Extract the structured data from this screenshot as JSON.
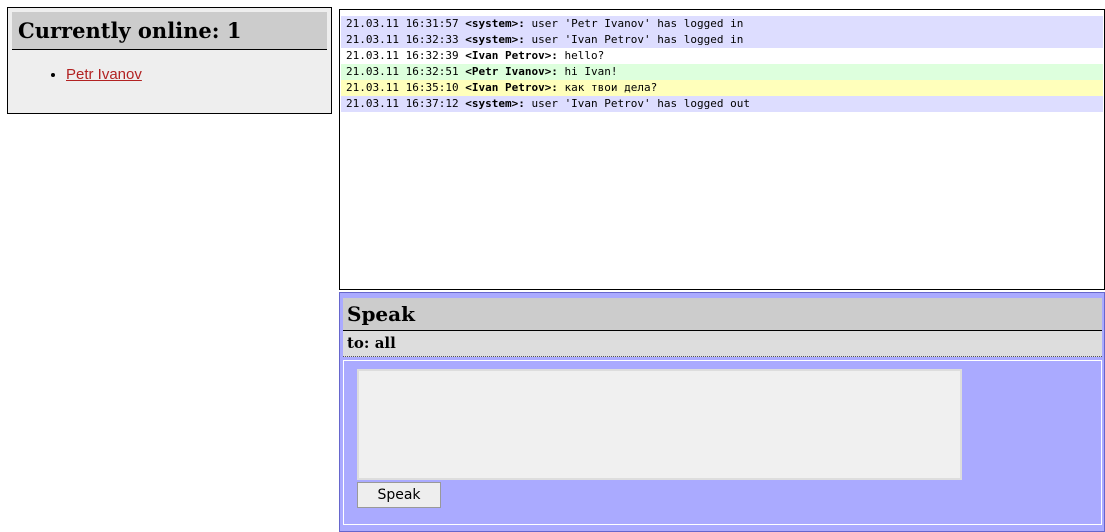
{
  "online": {
    "title": "Currently online: 1",
    "users": [
      "Petr Ivanov"
    ]
  },
  "chat": {
    "messages": [
      {
        "time": "21.03.11 16:31:57",
        "sender": "<system>:",
        "text": " user 'Petr Ivanov' has logged in",
        "bg": "#ddddff"
      },
      {
        "time": "21.03.11 16:32:33",
        "sender": "<system>:",
        "text": " user 'Ivan Petrov' has logged in",
        "bg": "#ddddff"
      },
      {
        "time": "21.03.11 16:32:39",
        "sender": "<Ivan Petrov>:",
        "text": " hello?",
        "bg": "#ffffff"
      },
      {
        "time": "21.03.11 16:32:51",
        "sender": "<Petr Ivanov>:",
        "text": " hi Ivan!",
        "bg": "#ddffdd"
      },
      {
        "time": "21.03.11 16:35:10",
        "sender": "<Ivan Petrov>:",
        "text": " как твои дела?",
        "bg": "#ffffbb"
      },
      {
        "time": "21.03.11 16:37:12",
        "sender": "<system>:",
        "text": " user 'Ivan Petrov' has logged out",
        "bg": "#ddddff"
      }
    ]
  },
  "speak": {
    "title": "Speak",
    "to_label": "to: all",
    "input_value": "",
    "button_label": "Speak"
  },
  "colors": {
    "speak_bg": "#aaaaff",
    "system_row": "#ddddff",
    "peer_row": "#ddffdd",
    "self_row": "#ffffbb",
    "link": "#b22222"
  }
}
